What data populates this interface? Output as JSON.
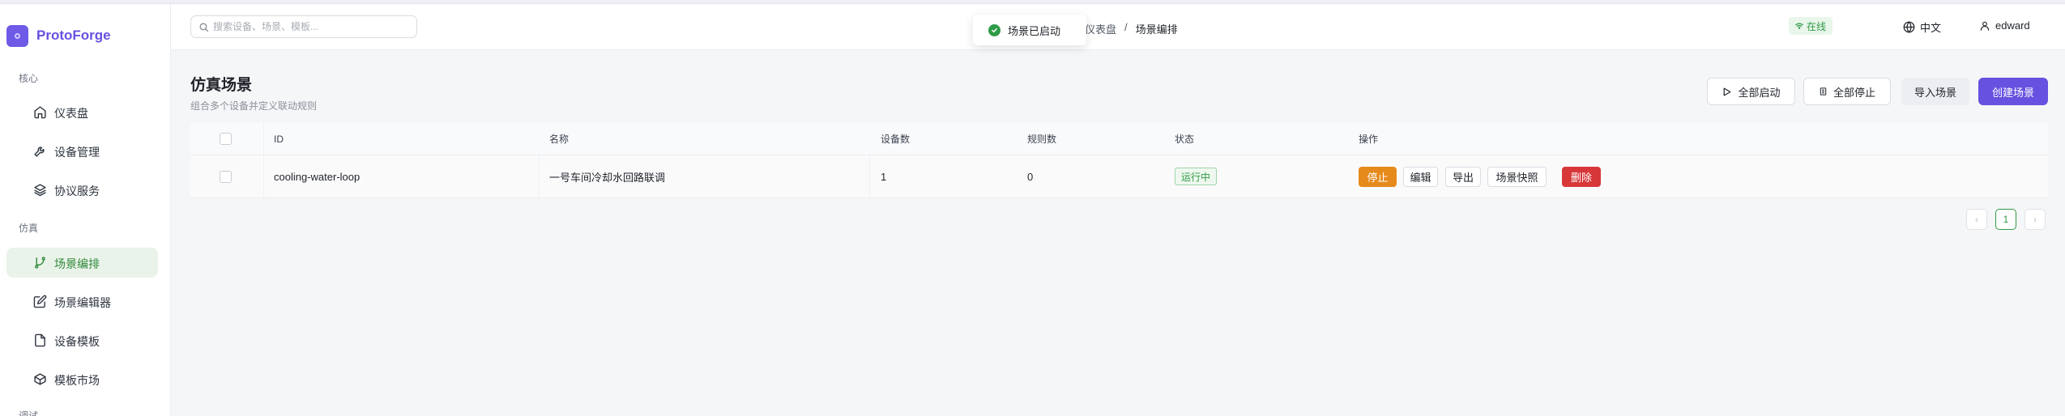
{
  "app": {
    "name": "ProtoForge"
  },
  "sidebar": {
    "sections": [
      {
        "label": "核心"
      },
      {
        "label": "仿真"
      },
      {
        "label": "调试"
      }
    ],
    "items": [
      {
        "label": "仪表盘",
        "icon": "home-icon"
      },
      {
        "label": "设备管理",
        "icon": "wrench-icon"
      },
      {
        "label": "协议服务",
        "icon": "layers-icon"
      },
      {
        "label": "场景编排",
        "icon": "git-branch-icon",
        "active": true
      },
      {
        "label": "场景编辑器",
        "icon": "edit-icon"
      },
      {
        "label": "设备模板",
        "icon": "file-icon"
      },
      {
        "label": "模板市场",
        "icon": "box-icon"
      }
    ]
  },
  "header": {
    "search_placeholder": "搜索设备、场景、模板...",
    "breadcrumb": {
      "parent": "仪表盘",
      "separator": "/",
      "current": "场景编排"
    },
    "status": "在线",
    "language": "中文",
    "user": "edward"
  },
  "toast": {
    "message": "场景已启动",
    "color": "#2e9b47"
  },
  "page": {
    "title": "仿真场景",
    "subtitle": "组合多个设备并定义联动规则",
    "buttons": {
      "start_all": "全部启动",
      "stop_all": "全部停止",
      "import": "导入场景",
      "create": "创建场景"
    }
  },
  "table": {
    "columns": [
      "ID",
      "名称",
      "设备数",
      "规则数",
      "状态",
      "操作"
    ],
    "rows": [
      {
        "id": "cooling-water-loop",
        "name": "一号车间冷却水回路联调",
        "devices": "1",
        "rules": "0",
        "status": "运行中",
        "actions": {
          "stop": "停止",
          "edit": "编辑",
          "export": "导出",
          "snapshot": "场景快照",
          "delete": "删除"
        }
      }
    ]
  },
  "pagination": {
    "prev": "‹",
    "current": "1",
    "next": "›"
  },
  "colors": {
    "brand": "#6651e0",
    "active_green": "#2f9a44",
    "warning": "#e68a1c",
    "danger": "#d8373a"
  }
}
